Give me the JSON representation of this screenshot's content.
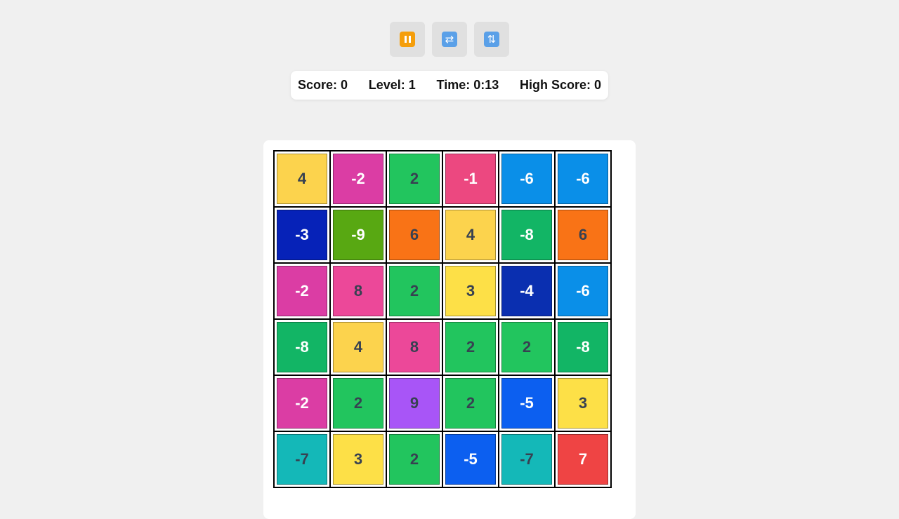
{
  "controls": [
    {
      "name": "pause-button",
      "icon": "pause-icon"
    },
    {
      "name": "restart-button",
      "icon": "restart-icon"
    },
    {
      "name": "new-game-button",
      "icon": "refresh-icon"
    }
  ],
  "stats": {
    "score": "Score: 0",
    "level": "Level: 1",
    "time": "Time: 0:13",
    "high_score": "High Score: 0"
  },
  "board": [
    [
      {
        "value": "4",
        "color": "#fcd34d",
        "text": "#374151"
      },
      {
        "value": "-2",
        "color": "#db3da4",
        "text": "#ffffff"
      },
      {
        "value": "2",
        "color": "#22c55e",
        "text": "#374151"
      },
      {
        "value": "-1",
        "color": "#ec4880",
        "text": "#ffffff"
      },
      {
        "value": "-6",
        "color": "#0a8fe8",
        "text": "#ffffff"
      },
      {
        "value": "-6",
        "color": "#0a8fe8",
        "text": "#ffffff"
      }
    ],
    [
      {
        "value": "-3",
        "color": "#0622b8",
        "text": "#ffffff"
      },
      {
        "value": "-9",
        "color": "#58a812",
        "text": "#ffffff"
      },
      {
        "value": "6",
        "color": "#f97316",
        "text": "#374151"
      },
      {
        "value": "4",
        "color": "#fcd34d",
        "text": "#374151"
      },
      {
        "value": "-8",
        "color": "#12b565",
        "text": "#ffffff"
      },
      {
        "value": "6",
        "color": "#f97316",
        "text": "#374151"
      }
    ],
    [
      {
        "value": "-2",
        "color": "#db3da4",
        "text": "#ffffff"
      },
      {
        "value": "8",
        "color": "#ec4899",
        "text": "#374151"
      },
      {
        "value": "2",
        "color": "#22c55e",
        "text": "#374151"
      },
      {
        "value": "3",
        "color": "#fde047",
        "text": "#374151"
      },
      {
        "value": "-4",
        "color": "#0a2fb0",
        "text": "#ffffff"
      },
      {
        "value": "-6",
        "color": "#0a8fe8",
        "text": "#ffffff"
      }
    ],
    [
      {
        "value": "-8",
        "color": "#12b565",
        "text": "#ffffff"
      },
      {
        "value": "4",
        "color": "#fcd34d",
        "text": "#374151"
      },
      {
        "value": "8",
        "color": "#ec4899",
        "text": "#374151"
      },
      {
        "value": "2",
        "color": "#22c55e",
        "text": "#374151"
      },
      {
        "value": "2",
        "color": "#22c55e",
        "text": "#374151"
      },
      {
        "value": "-8",
        "color": "#12b565",
        "text": "#ffffff"
      }
    ],
    [
      {
        "value": "-2",
        "color": "#db3da4",
        "text": "#ffffff"
      },
      {
        "value": "2",
        "color": "#22c55e",
        "text": "#374151"
      },
      {
        "value": "9",
        "color": "#a855f7",
        "text": "#374151"
      },
      {
        "value": "2",
        "color": "#22c55e",
        "text": "#374151"
      },
      {
        "value": "-5",
        "color": "#0c5ff0",
        "text": "#ffffff"
      },
      {
        "value": "3",
        "color": "#fde047",
        "text": "#374151"
      }
    ],
    [
      {
        "value": "-7",
        "color": "#14b8b8",
        "text": "#374151"
      },
      {
        "value": "3",
        "color": "#fde047",
        "text": "#374151"
      },
      {
        "value": "2",
        "color": "#22c55e",
        "text": "#374151"
      },
      {
        "value": "-5",
        "color": "#0c5ff0",
        "text": "#ffffff"
      },
      {
        "value": "-7",
        "color": "#14b8b8",
        "text": "#374151"
      },
      {
        "value": "7",
        "color": "#ef4444",
        "text": "#ffffff"
      }
    ]
  ]
}
